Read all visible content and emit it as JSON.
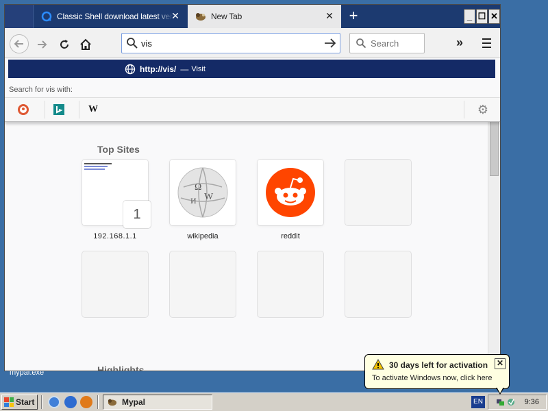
{
  "desktop": {
    "icon_label": "mypal.exe"
  },
  "browser": {
    "tabs": [
      {
        "title": "Classic Shell download latest versi",
        "active": false
      },
      {
        "title": "New Tab",
        "active": true
      }
    ],
    "window_buttons": {
      "minimize": "_",
      "maximize": "☐",
      "close": "✕"
    },
    "urlbar": {
      "value": "vis"
    },
    "searchbar": {
      "placeholder": "Search"
    },
    "dropdown": {
      "suggestion_url": "http://vis/",
      "suggestion_separator": "—",
      "suggestion_action": "Visit",
      "search_with_label": "Search for vis with:",
      "engines": [
        "DuckDuckGo",
        "Bing",
        "Wikipedia"
      ]
    },
    "new_tab": {
      "top_sites_heading": "Top Sites",
      "sites": [
        {
          "label": "192.168.1.1",
          "badge": "1"
        },
        {
          "label": "wikipedia"
        },
        {
          "label": "reddit"
        }
      ],
      "highlights_heading": "Highlights"
    }
  },
  "taskbar": {
    "start_label": "Start",
    "task_label": "Mypal",
    "lang": "EN",
    "clock": "9:36"
  },
  "balloon": {
    "title": "30 days left for activation",
    "text": "To activate Windows now, click here",
    "close": "✕"
  },
  "colors": {
    "tabstrip": "#1c3a70",
    "suggest_highlight": "#142a66",
    "reddit": "#ff4500",
    "desktop": "#3a6ea5",
    "balloon_bg": "#ffffe1"
  }
}
